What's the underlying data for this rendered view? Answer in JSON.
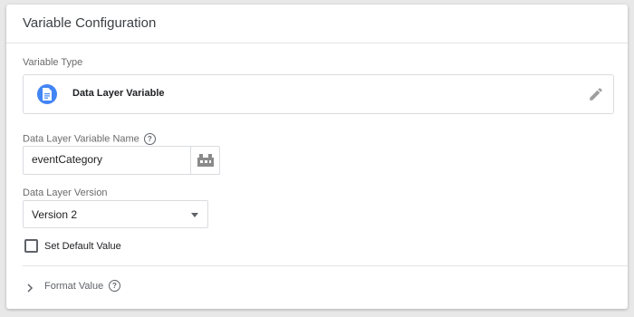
{
  "card": {
    "title": "Variable Configuration"
  },
  "variable_type": {
    "section_label": "Variable Type",
    "name": "Data Layer Variable",
    "icon": "document-icon",
    "accent_color": "#4285f4"
  },
  "dlv_name": {
    "label": "Data Layer Variable Name",
    "value": "eventCategory",
    "help_icon": "help-icon",
    "picker_icon": "variable-picker-icon"
  },
  "dl_version": {
    "label": "Data Layer Version",
    "selected": "Version 2"
  },
  "default_value": {
    "label": "Set Default Value",
    "checked": false
  },
  "format_value": {
    "label": "Format Value",
    "expanded": false
  }
}
